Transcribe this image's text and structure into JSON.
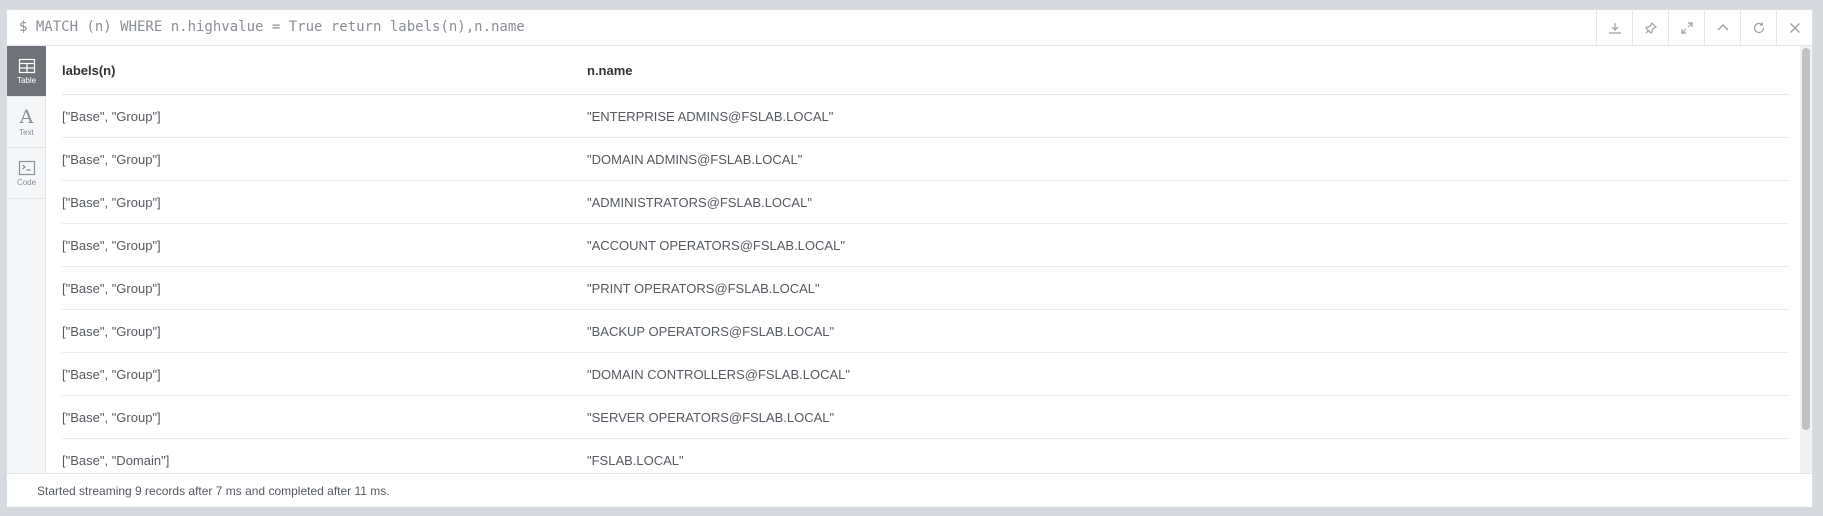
{
  "query": {
    "text": "$ MATCH (n) WHERE n.highvalue = True return labels(n),n.name"
  },
  "toolbar": {
    "buttons": [
      {
        "name": "download-icon"
      },
      {
        "name": "pin-icon"
      },
      {
        "name": "expand-icon"
      },
      {
        "name": "collapse-up-icon"
      },
      {
        "name": "rerun-icon"
      },
      {
        "name": "close-icon"
      }
    ]
  },
  "sidebar": {
    "items": [
      {
        "label": "Table",
        "icon": "table-icon",
        "active": true
      },
      {
        "label": "Text",
        "icon": "text-icon",
        "active": false
      },
      {
        "label": "Code",
        "icon": "code-icon",
        "active": false
      }
    ]
  },
  "table": {
    "headers": [
      "labels(n)",
      "n.name"
    ],
    "rows": [
      [
        "[\"Base\", \"Group\"]",
        "\"ENTERPRISE ADMINS@FSLAB.LOCAL\""
      ],
      [
        "[\"Base\", \"Group\"]",
        "\"DOMAIN ADMINS@FSLAB.LOCAL\""
      ],
      [
        "[\"Base\", \"Group\"]",
        "\"ADMINISTRATORS@FSLAB.LOCAL\""
      ],
      [
        "[\"Base\", \"Group\"]",
        "\"ACCOUNT OPERATORS@FSLAB.LOCAL\""
      ],
      [
        "[\"Base\", \"Group\"]",
        "\"PRINT OPERATORS@FSLAB.LOCAL\""
      ],
      [
        "[\"Base\", \"Group\"]",
        "\"BACKUP OPERATORS@FSLAB.LOCAL\""
      ],
      [
        "[\"Base\", \"Group\"]",
        "\"DOMAIN CONTROLLERS@FSLAB.LOCAL\""
      ],
      [
        "[\"Base\", \"Group\"]",
        "\"SERVER OPERATORS@FSLAB.LOCAL\""
      ],
      [
        "[\"Base\", \"Domain\"]",
        "\"FSLAB.LOCAL\""
      ]
    ]
  },
  "footer": {
    "status": "Started streaming 9 records after 7 ms and completed after 11 ms."
  },
  "colors": {
    "active_tab_bg": "#6f7379",
    "text": "#555a60",
    "border": "#e4e6e9"
  }
}
